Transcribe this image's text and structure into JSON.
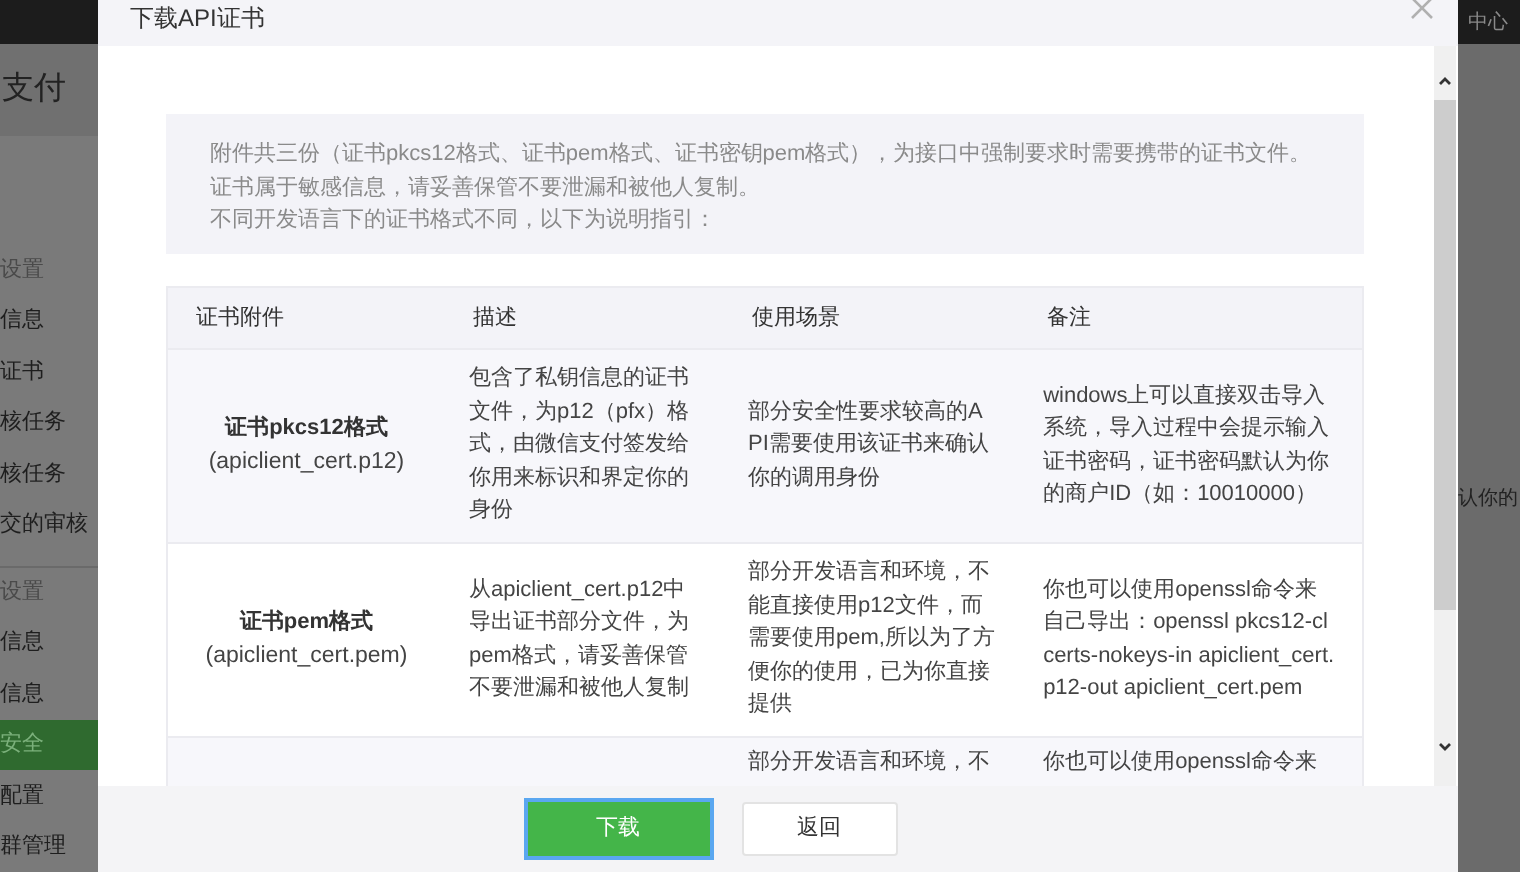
{
  "background": {
    "top_bar_text": "中心",
    "nav_title": "支付",
    "side_text": "认你的",
    "sidebar": [
      {
        "label": "设置",
        "kind": "header",
        "selected": false
      },
      {
        "label": "信息",
        "kind": "item",
        "selected": false
      },
      {
        "label": "证书",
        "kind": "item",
        "selected": false
      },
      {
        "label": "核任务",
        "kind": "item",
        "selected": false
      },
      {
        "label": "核任务",
        "kind": "item",
        "selected": false
      },
      {
        "label": "交的审核",
        "kind": "item",
        "selected": false
      },
      {
        "label": "设置",
        "kind": "header",
        "selected": false
      },
      {
        "label": "信息",
        "kind": "item",
        "selected": false
      },
      {
        "label": "信息",
        "kind": "item",
        "selected": false
      },
      {
        "label": "安全",
        "kind": "item",
        "selected": true
      },
      {
        "label": "配置",
        "kind": "item",
        "selected": false
      },
      {
        "label": "群管理",
        "kind": "item",
        "selected": false
      }
    ]
  },
  "dialog": {
    "title": "下载API证书",
    "intro": [
      "附件共三份（证书pkcs12格式、证书pem格式、证书密钥pem格式），为接口中强制要求时需要携带的证书文件。证书属于敏感信息，请妥善保管不要泄漏和被他人复制。",
      "不同开发语言下的证书格式不同，以下为说明指引："
    ],
    "table": {
      "columns": [
        "证书附件",
        "描述",
        "使用场景",
        "备注"
      ],
      "rows": [
        {
          "name": "证书pkcs12格式",
          "file": "(apiclient_cert.p12)",
          "description": "包含了私钥信息的证书文件，为p12（pfx）格式，由微信支付签发给你用来标识和界定你的身份",
          "scenario": "部分安全性要求较高的API需要使用该证书来确认你的调用身份",
          "note": "windows上可以直接双击导入系统，导入过程中会提示输入证书密码，证书密码默认为你的商户ID（如：10010000）"
        },
        {
          "name": "证书pem格式",
          "file": "(apiclient_cert.pem)",
          "description": "从apiclient_cert.p12中导出证书部分文件，为pem格式，请妥善保管不要泄漏和被他人复制",
          "scenario": "部分开发语言和环境，不能直接使用p12文件，而需要使用pem,所以为了方便你的使用，已为你直接提供",
          "note": "你也可以使用openssl命令来自己导出：openssl pkcs12-clcerts-nokeys-in apiclient_cert.p12-out apiclient_cert.pem"
        },
        {
          "scenario": "部分开发语言和环境，不",
          "note": "你也可以使用openssl命令来"
        }
      ]
    },
    "buttons": [
      {
        "label": "下载",
        "kind": "primary"
      },
      {
        "label": "返回",
        "kind": "secondary"
      }
    ]
  }
}
